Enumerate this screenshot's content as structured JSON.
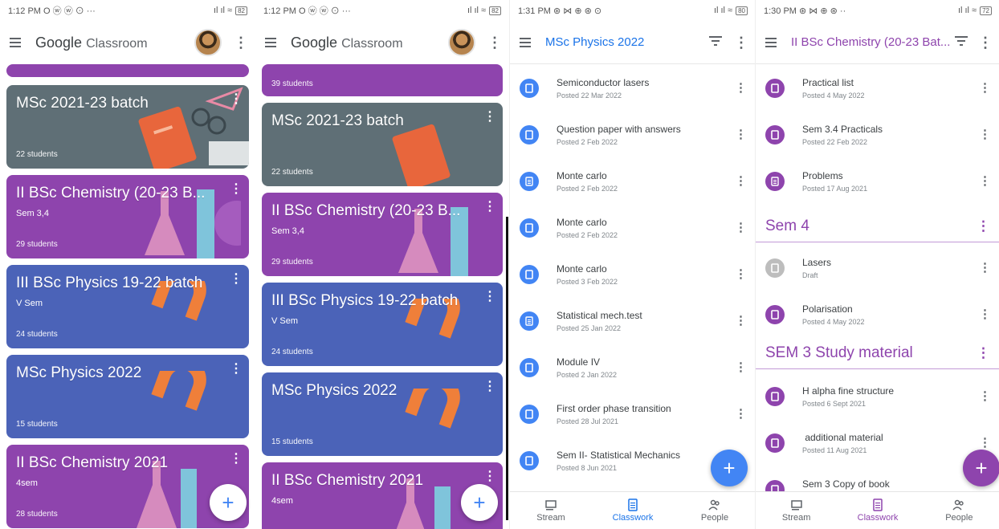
{
  "panels": [
    {
      "status": {
        "time": "1:12 PM",
        "icons": "O ⓦ ⓦ ⊙ ···",
        "signal": "ıl ıl ≈",
        "battery": "82"
      },
      "appbar": {
        "title": "Google",
        "title_suffix": "Classroom"
      },
      "cards": [
        {
          "title": "MSc 2021-23 batch",
          "subtitle": "",
          "students": "22 students",
          "color": "#5f6f76"
        },
        {
          "title": "II BSc Chemistry (20-23 B...",
          "subtitle": "Sem 3,4",
          "students": "29 students",
          "color": "#8e44ad"
        },
        {
          "title": "III BSc Physics 19-22 batch",
          "subtitle": "V Sem",
          "students": "24 students",
          "color": "#4b63b8"
        },
        {
          "title": "MSc Physics 2022",
          "subtitle": "",
          "students": "15 students",
          "color": "#4b63b8"
        },
        {
          "title": "II BSc Chemistry 2021",
          "subtitle": "4sem",
          "students": "28 students",
          "color": "#8e44ad"
        }
      ]
    },
    {
      "status": {
        "time": "1:12 PM",
        "icons": "O ⓦ ⓦ ⊙ ···",
        "signal": "ıl ıl ≈",
        "battery": "82"
      },
      "appbar": {
        "title": "Google",
        "title_suffix": "Classroom"
      },
      "top_card": {
        "students": "39 students"
      },
      "cards": [
        {
          "title": "MSc 2021-23 batch",
          "subtitle": "",
          "students": "22 students",
          "color": "#5f6f76"
        },
        {
          "title": "II BSc Chemistry (20-23 B...",
          "subtitle": "Sem 3,4",
          "students": "29 students",
          "color": "#8e44ad"
        },
        {
          "title": "III BSc Physics 19-22 batch",
          "subtitle": "V Sem",
          "students": "24 students",
          "color": "#4b63b8"
        },
        {
          "title": "MSc Physics 2022",
          "subtitle": "",
          "students": "15 students",
          "color": "#4b63b8"
        },
        {
          "title": "II BSc Chemistry 2021",
          "subtitle": "4sem",
          "students": "",
          "color": "#8e44ad"
        }
      ]
    },
    {
      "status": {
        "time": "1:31 PM",
        "icons": "⊛ ⋈ ⊕ ⊛ ⊙",
        "signal": "ıl ıl ≈",
        "battery": "80"
      },
      "appbar": {
        "title": "MSc Physics 2022"
      },
      "items": [
        {
          "title": "Semiconductor lasers",
          "date": "Posted 22 Mar 2022",
          "icon": "material"
        },
        {
          "title": "Question paper with answers",
          "date": "Posted 2 Feb 2022",
          "icon": "material"
        },
        {
          "title": "Monte carlo",
          "date": "Posted 2 Feb 2022",
          "icon": "assignment"
        },
        {
          "title": "Monte carlo",
          "date": "Posted 2 Feb 2022",
          "icon": "material"
        },
        {
          "title": "Monte carlo",
          "date": "Posted 3 Feb 2022",
          "icon": "material"
        },
        {
          "title": "Statistical mech.test",
          "date": "Posted 25 Jan 2022",
          "icon": "assignment"
        },
        {
          "title": "Module IV",
          "date": "Posted 2 Jan 2022",
          "icon": "material"
        },
        {
          "title": "First order phase transition",
          "date": "Posted 28 Jul 2021",
          "icon": "material"
        },
        {
          "title": "Sem II- Statistical Mechanics",
          "date": "Posted 8 Jun 2021",
          "icon": "material"
        }
      ],
      "nav": [
        {
          "label": "Stream"
        },
        {
          "label": "Classwork"
        },
        {
          "label": "People"
        }
      ]
    },
    {
      "status": {
        "time": "1:30 PM",
        "icons": "⊛ ⋈ ⊕ ⊛ ··",
        "signal": "ıl ıl ≈",
        "battery": "72"
      },
      "appbar": {
        "title": "II BSc Chemistry (20-23 Bat..."
      },
      "items_top": [
        {
          "title": "Practical list",
          "date": "Posted 4 May 2022",
          "icon": "material"
        },
        {
          "title": "Sem 3.4 Practicals",
          "date": "Posted 22 Feb 2022",
          "icon": "material"
        },
        {
          "title": "Problems",
          "date": "Posted 17 Aug 2021",
          "icon": "assignment"
        }
      ],
      "topic1": "Sem 4",
      "items_mid": [
        {
          "title": "Lasers",
          "date": "Draft",
          "icon": "draft"
        },
        {
          "title": "Polarisation",
          "date": "Posted 4 May 2022",
          "icon": "material"
        }
      ],
      "topic2": "SEM 3 Study material",
      "items_bottom": [
        {
          "title": "H alpha fine structure",
          "date": "Posted 6 Sept 2021",
          "icon": "material"
        },
        {
          "title": " additional material",
          "date": "Posted 11 Aug 2021",
          "icon": "material"
        },
        {
          "title": "Sem 3 Copy of book",
          "date": "",
          "icon": "material"
        }
      ],
      "nav": [
        {
          "label": "Stream"
        },
        {
          "label": "Classwork"
        },
        {
          "label": "People"
        }
      ]
    }
  ],
  "fab_symbol": "+",
  "colors": {
    "blue": "#4285f4",
    "purple": "#8e44ad",
    "grey": "#5f6f76"
  }
}
